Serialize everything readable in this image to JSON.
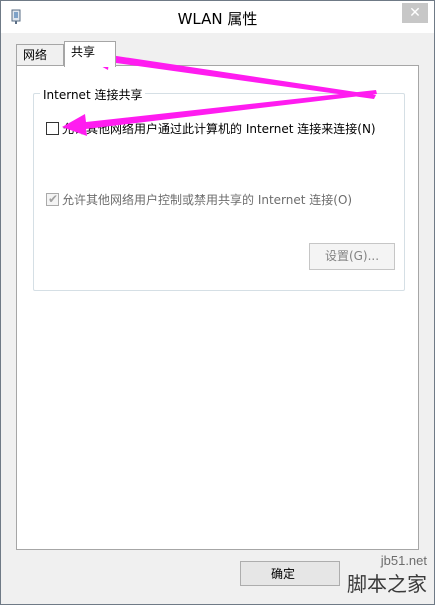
{
  "window": {
    "title": "WLAN 属性",
    "close_label": "✕"
  },
  "tabs": [
    {
      "label": "网络",
      "selected": false
    },
    {
      "label": "共享",
      "selected": true
    }
  ],
  "sharing": {
    "group_title": "Internet 连接共享",
    "allow_share_label": "允许其他网络用户通过此计算机的 Internet 连接来连接(N)",
    "allow_share_checked": false,
    "allow_control_label": "允许其他网络用户控制或禁用共享的 Internet 连接(O)",
    "allow_control_checked": true,
    "allow_control_enabled": false,
    "settings_button_label": "设置(G)..."
  },
  "footer": {
    "ok_label": "确定"
  },
  "watermark": {
    "url": "jb51.net",
    "name": "脚本之家"
  },
  "colors": {
    "annotation_arrow": "#ff1cf0",
    "panel_background": "#ffffff",
    "window_background": "#f0f0f0"
  }
}
